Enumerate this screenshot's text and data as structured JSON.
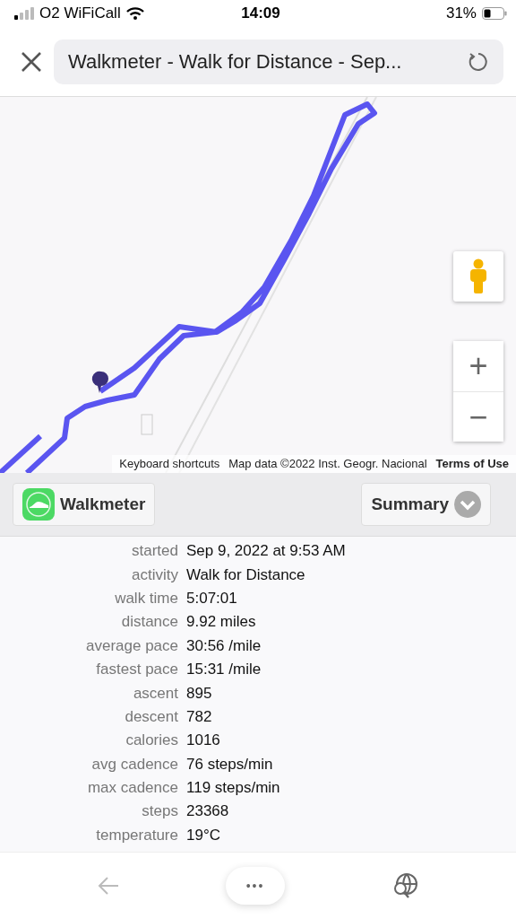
{
  "status_bar": {
    "carrier": "O2 WiFiCall",
    "time": "14:09",
    "battery": "31%"
  },
  "header": {
    "title": "Walkmeter - Walk for Distance - Sep..."
  },
  "map": {
    "attribution": [
      "Keyboard shortcuts",
      "Map data ©2022 Inst. Geogr. Nacional"
    ],
    "terms": "Terms of Use",
    "zoom_in": "+",
    "zoom_out": "−"
  },
  "toolbar": {
    "app_button": "Walkmeter",
    "view_button": "Summary"
  },
  "stats": [
    {
      "label": "started",
      "value": "Sep 9, 2022 at 9:53 AM"
    },
    {
      "label": "activity",
      "value": "Walk for Distance"
    },
    {
      "label": "walk time",
      "value": "5:07:01"
    },
    {
      "label": "distance",
      "value": "9.92 miles"
    },
    {
      "label": "average pace",
      "value": "30:56 /mile"
    },
    {
      "label": "fastest pace",
      "value": "15:31 /mile"
    },
    {
      "label": "ascent",
      "value": "895"
    },
    {
      "label": "descent",
      "value": "782"
    },
    {
      "label": "calories",
      "value": "1016"
    },
    {
      "label": "avg cadence",
      "value": "76 steps/min"
    },
    {
      "label": "max cadence",
      "value": "119 steps/min"
    },
    {
      "label": "steps",
      "value": "23368"
    },
    {
      "label": "temperature",
      "value": "19°C"
    }
  ],
  "bottom_bar": {
    "more": "•••"
  }
}
